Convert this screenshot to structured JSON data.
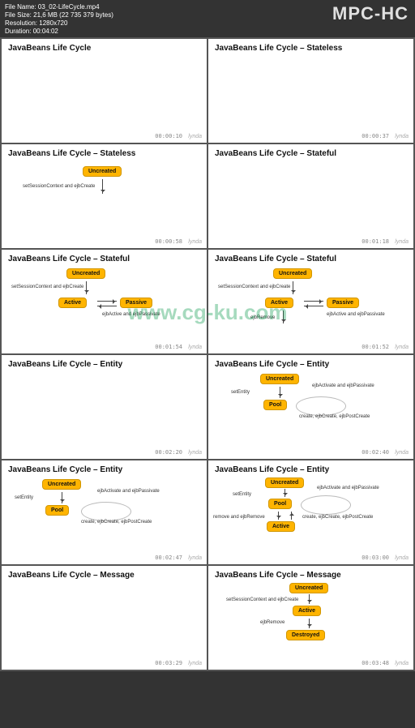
{
  "app": {
    "logo": "MPC-HC"
  },
  "meta": {
    "filename_label": "File Name:",
    "filename": "03_02-LifeCycle.mp4",
    "filesize_label": "File Size:",
    "filesize": "21,6 MB (22 735 379 bytes)",
    "resolution_label": "Resolution:",
    "resolution": "1280x720",
    "duration_label": "Duration:",
    "duration": "00:04:02"
  },
  "brand": "lynda",
  "watermark": "www.cg-ku.com",
  "thumbs": [
    {
      "title": "JavaBeans Life Cycle",
      "ts": "00:00:10"
    },
    {
      "title": "JavaBeans Life Cycle – Stateless",
      "ts": "00:00:37"
    },
    {
      "title": "JavaBeans Life Cycle – Stateless",
      "ts": "00:00:58",
      "states": {
        "uncreated": "Uncreated"
      },
      "labels": {
        "ctx": "setSessionContext and ejbCreate"
      }
    },
    {
      "title": "JavaBeans Life Cycle – Stateful",
      "ts": "00:01:18"
    },
    {
      "title": "JavaBeans Life Cycle – Stateful",
      "ts": "00:01:54",
      "states": {
        "uncreated": "Uncreated",
        "active": "Active",
        "passive": "Passive"
      },
      "labels": {
        "ctx": "setSessionContext and ejbCreate",
        "ap": "ejbActive and ejbPassivate"
      }
    },
    {
      "title": "JavaBeans Life Cycle – Stateful",
      "ts": "00:01:52",
      "states": {
        "uncreated": "Uncreated",
        "active": "Active",
        "passive": "Passive"
      },
      "labels": {
        "ctx": "setSessionContext and ejbCreate",
        "ap": "ejbActive and ejbPassivate",
        "rem": "ejbRemove"
      }
    },
    {
      "title": "JavaBeans Life Cycle – Entity",
      "ts": "00:02:20"
    },
    {
      "title": "JavaBeans Life Cycle – Entity",
      "ts": "00:02:40",
      "states": {
        "uncreated": "Uncreated",
        "pool": "Pool"
      },
      "labels": {
        "set": "setEntity",
        "ap": "ejbActivate and ejbPassivate",
        "cep": "create, ejbCreate, ejbPostCreate"
      }
    },
    {
      "title": "JavaBeans Life Cycle – Entity",
      "ts": "00:02:47",
      "states": {
        "uncreated": "Uncreated",
        "pool": "Pool"
      },
      "labels": {
        "set": "setEntity",
        "ap": "ejbActivate and ejbPassivate",
        "cep": "create, ejbCreate, ejbPostCreate"
      }
    },
    {
      "title": "JavaBeans Life Cycle – Entity",
      "ts": "00:03:00",
      "states": {
        "uncreated": "Uncreated",
        "pool": "Pool",
        "active": "Active"
      },
      "labels": {
        "set": "setEntity",
        "ap": "ejbActivate and ejbPassivate",
        "cep": "create, ejbCreate, ejbPostCreate",
        "rem": "remove and ejbRemove"
      }
    },
    {
      "title": "JavaBeans Life Cycle – Message",
      "ts": "00:03:29"
    },
    {
      "title": "JavaBeans Life Cycle – Message",
      "ts": "00:03:48",
      "states": {
        "uncreated": "Uncreated",
        "active": "Active",
        "destroyed": "Destroyed"
      },
      "labels": {
        "ctx": "setSessionContext and ejbCreate",
        "rem": "ejbRemove"
      }
    }
  ]
}
